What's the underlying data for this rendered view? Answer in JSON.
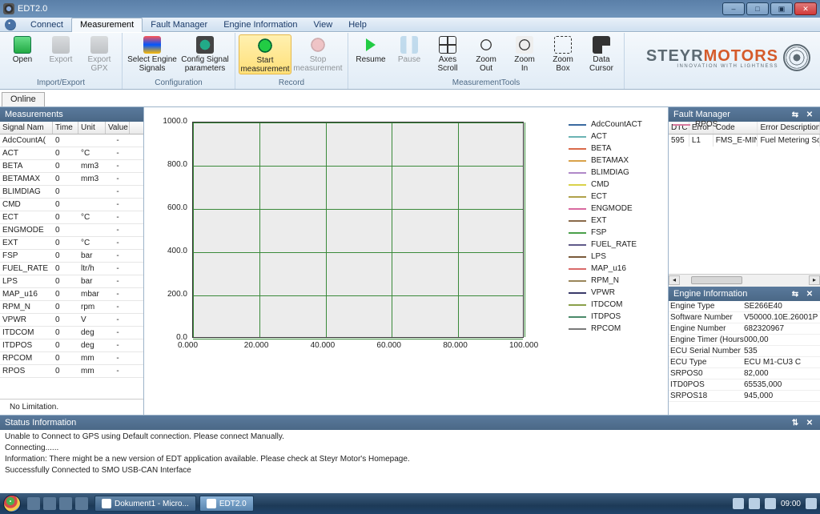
{
  "window": {
    "title": "EDT2.0"
  },
  "win_buttons": {
    "min": "–",
    "max": "□",
    "max2": "▣",
    "close": "✕"
  },
  "ribbon_tabs": [
    "Connect",
    "Measurement",
    "Fault Manager",
    "Engine Information",
    "View",
    "Help"
  ],
  "ribbon_active": 1,
  "ribbon": {
    "groups": [
      {
        "name": "Import/Export",
        "items": [
          {
            "label": "Open",
            "icon": "ico-open",
            "enabled": true
          },
          {
            "label": "Export",
            "icon": "ico-export",
            "enabled": false
          },
          {
            "label": "Export\nGPX",
            "icon": "ico-export",
            "enabled": false
          }
        ]
      },
      {
        "name": "Configuration",
        "items": [
          {
            "label": "Select Engine\nSignals",
            "icon": "ico-sel",
            "enabled": true,
            "wide": true
          },
          {
            "label": "Config Signal\nparameters",
            "icon": "ico-cfg",
            "enabled": true,
            "wide": true
          }
        ]
      },
      {
        "name": "Record",
        "items": [
          {
            "label": "Start\nmeasurement",
            "icon": "ico-start",
            "enabled": true,
            "highlight": true,
            "wide": true
          },
          {
            "label": "Stop\nmeasurement",
            "icon": "ico-stop",
            "enabled": false,
            "wide": true
          }
        ]
      },
      {
        "name": "MeasurementTools",
        "items": [
          {
            "label": "Resume",
            "icon": "ico-play",
            "enabled": true
          },
          {
            "label": "Pause",
            "icon": "ico-pause",
            "enabled": false
          },
          {
            "label": "Axes\nScroll",
            "icon": "ico-axes",
            "enabled": true
          },
          {
            "label": "Zoom\nOut",
            "icon": "ico-zoomo",
            "enabled": true
          },
          {
            "label": "Zoom\nIn",
            "icon": "ico-zoomi",
            "enabled": true
          },
          {
            "label": "Zoom\nBox",
            "icon": "ico-zbox",
            "enabled": true
          },
          {
            "label": "Data\nCursor",
            "icon": "ico-cursor",
            "enabled": true
          }
        ]
      }
    ]
  },
  "brand": {
    "part1": "STEYR",
    "part2": "MOTORS",
    "sub": "INNOVATION WITH LIGHTNESS"
  },
  "sub_tab": "Online",
  "meas": {
    "title": "Measurements",
    "headers": [
      "Signal Nam",
      "Time",
      "Unit",
      "Value"
    ],
    "rows": [
      {
        "name": "AdcCountA(",
        "time": "0",
        "unit": "",
        "val": "-"
      },
      {
        "name": "ACT",
        "time": "0",
        "unit": "°C",
        "val": "-"
      },
      {
        "name": "BETA",
        "time": "0",
        "unit": "mm3",
        "val": "-"
      },
      {
        "name": "BETAMAX",
        "time": "0",
        "unit": "mm3",
        "val": "-"
      },
      {
        "name": "BLIMDIAG",
        "time": "0",
        "unit": "",
        "val": "-"
      },
      {
        "name": "CMD",
        "time": "0",
        "unit": "",
        "val": "-"
      },
      {
        "name": "ECT",
        "time": "0",
        "unit": "°C",
        "val": "-"
      },
      {
        "name": "ENGMODE",
        "time": "0",
        "unit": "",
        "val": "-"
      },
      {
        "name": "EXT",
        "time": "0",
        "unit": "°C",
        "val": "-"
      },
      {
        "name": "FSP",
        "time": "0",
        "unit": "bar",
        "val": "-"
      },
      {
        "name": "FUEL_RATE",
        "time": "0",
        "unit": "ltr/h",
        "val": "-"
      },
      {
        "name": "LPS",
        "time": "0",
        "unit": "bar",
        "val": "-"
      },
      {
        "name": "MAP_u16",
        "time": "0",
        "unit": "mbar",
        "val": "-"
      },
      {
        "name": "RPM_N",
        "time": "0",
        "unit": "rpm",
        "val": "-"
      },
      {
        "name": "VPWR",
        "time": "0",
        "unit": "V",
        "val": "-"
      },
      {
        "name": "ITDCOM",
        "time": "0",
        "unit": "deg",
        "val": "-"
      },
      {
        "name": "ITDPOS",
        "time": "0",
        "unit": "deg",
        "val": "-"
      },
      {
        "name": "RPCOM",
        "time": "0",
        "unit": "mm",
        "val": "-"
      },
      {
        "name": "RPOS",
        "time": "0",
        "unit": "mm",
        "val": "-"
      }
    ],
    "footer": "No Limitation."
  },
  "chart_data": {
    "type": "line",
    "series": [
      {
        "name": "AdcCountACT",
        "color": "#3a6aa0",
        "values": []
      },
      {
        "name": "ACT",
        "color": "#6bb3b3",
        "values": []
      },
      {
        "name": "BETA",
        "color": "#d96a4a",
        "values": []
      },
      {
        "name": "BETAMAX",
        "color": "#d9a24a",
        "values": []
      },
      {
        "name": "BLIMDIAG",
        "color": "#b088c8",
        "values": []
      },
      {
        "name": "CMD",
        "color": "#d9d24a",
        "values": []
      },
      {
        "name": "ECT",
        "color": "#b0a24a",
        "values": []
      },
      {
        "name": "ENGMODE",
        "color": "#d96aa0",
        "values": []
      },
      {
        "name": "EXT",
        "color": "#8a6a4a",
        "values": []
      },
      {
        "name": "FSP",
        "color": "#4aa04a",
        "values": []
      },
      {
        "name": "FUEL_RATE",
        "color": "#605a8a",
        "values": []
      },
      {
        "name": "LPS",
        "color": "#7a5a3a",
        "values": []
      },
      {
        "name": "MAP_u16",
        "color": "#d96a6a",
        "values": []
      },
      {
        "name": "RPM_N",
        "color": "#9a865a",
        "values": []
      },
      {
        "name": "VPWR",
        "color": "#3a3a6a",
        "values": []
      },
      {
        "name": "ITDCOM",
        "color": "#8aa04a",
        "values": []
      },
      {
        "name": "ITDPOS",
        "color": "#4a8a6a",
        "values": []
      },
      {
        "name": "RPCOM",
        "color": "#7a7a7a",
        "values": []
      },
      {
        "name": "RPOS",
        "color": "#d97aa0",
        "values": []
      }
    ],
    "x_ticks": [
      "0.000",
      "20.000",
      "40.000",
      "60.000",
      "80.000",
      "100.000"
    ],
    "y_ticks": [
      "0.0",
      "200.0",
      "400.0",
      "600.0",
      "800.0",
      "1000.0"
    ],
    "xlim": [
      0,
      100
    ],
    "ylim": [
      0,
      1000
    ],
    "title": "",
    "xlabel": "",
    "ylabel": ""
  },
  "fault": {
    "title": "Fault Manager",
    "headers": [
      "DTC",
      "Error",
      "Code",
      "Error Description"
    ],
    "rows": [
      {
        "dtc": "595",
        "err": "L1",
        "code": "FMS_E-MIN",
        "desc": "Fuel Metering Sc"
      }
    ]
  },
  "engine": {
    "title": "Engine Information",
    "rows": [
      {
        "k": "Engine Type",
        "v": "SE266E40"
      },
      {
        "k": "Software Number",
        "v": "V50000.10E.26001P"
      },
      {
        "k": "Engine Number",
        "v": "682320967"
      },
      {
        "k": "Engine Timer (Hours",
        "v": "000,00"
      },
      {
        "k": "ECU Serial Number",
        "v": "535"
      },
      {
        "k": "ECU Type",
        "v": "ECU M1-CU3 C"
      },
      {
        "k": "SRPOS0",
        "v": "82,000"
      },
      {
        "k": "ITD0POS",
        "v": "65535,000"
      },
      {
        "k": "SRPOS18",
        "v": "945,000"
      }
    ]
  },
  "status": {
    "title": "Status Information",
    "lines": [
      "Unable to Connect to GPS using Default connection. Please connect Manually.",
      "Connecting......",
      "Information: There might be a new version of EDT application available. Please check at Steyr Motor's Homepage.",
      "Successfully Connected to SMO USB-CAN Interface"
    ]
  },
  "taskbar": {
    "items": [
      {
        "label": "Dokument1 - Micro...",
        "active": false
      },
      {
        "label": "EDT2.0",
        "active": true
      }
    ],
    "clock": "09:00"
  }
}
